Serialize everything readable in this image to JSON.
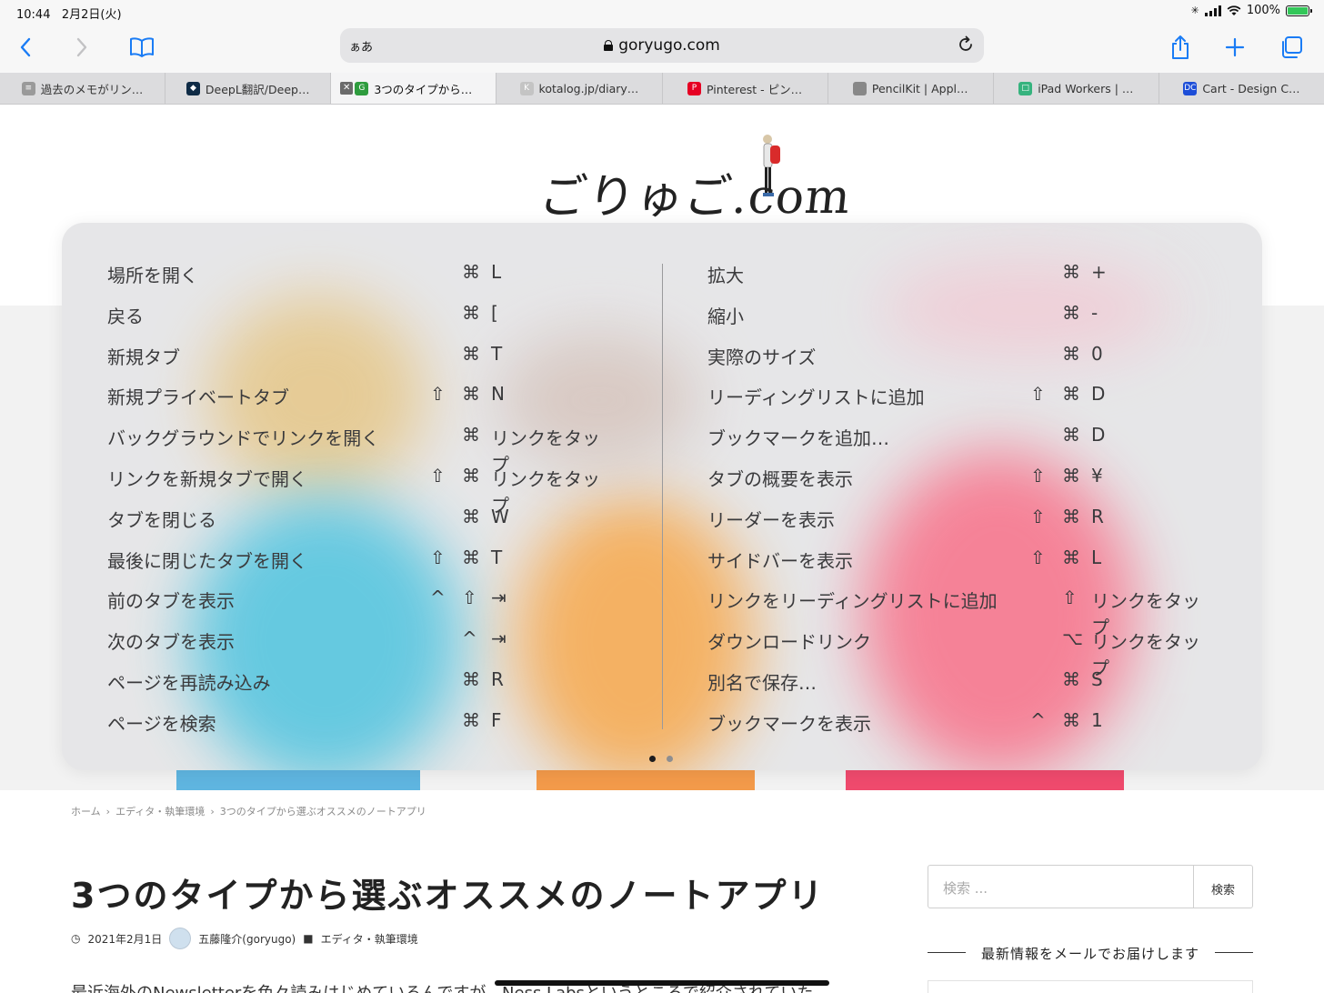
{
  "status": {
    "time": "10:44",
    "date": "2月2日(火)",
    "battery": "100%",
    "battery_fill": 1.0
  },
  "toolbar": {
    "text_size_label": "ぁあ",
    "url": "goryugo.com"
  },
  "tabs": [
    {
      "label": "過去のメモがリン…",
      "fav_color": "#9a9a9a",
      "fav_text": "≡"
    },
    {
      "label": "DeepL翻訳/Deep…",
      "fav_color": "#0f2b46",
      "fav_text": "◆"
    },
    {
      "label": "3つのタイプから…",
      "fav_color": "#2e9c3e",
      "fav_text": "G",
      "active": true
    },
    {
      "label": "kotalog.jp/diary…",
      "fav_color": "#c4c4c4",
      "fav_text": "K"
    },
    {
      "label": "Pinterest - ピン…",
      "fav_color": "#e60023",
      "fav_text": "P"
    },
    {
      "label": "PencilKit | Appl…",
      "fav_color": "#888888",
      "fav_text": ""
    },
    {
      "label": "iPad Workers | …",
      "fav_color": "#36b37e",
      "fav_text": "□"
    },
    {
      "label": "Cart - Design C…",
      "fav_color": "#1d4ed8",
      "fav_text": "DC"
    }
  ],
  "logo": {
    "text": "ごりゅご.com"
  },
  "shortcuts": {
    "left": [
      {
        "label": "場所を開く",
        "mods": [
          "",
          "⌘"
        ],
        "key": "L"
      },
      {
        "label": "戻る",
        "mods": [
          "",
          "⌘"
        ],
        "key": "["
      },
      {
        "label": "新規タブ",
        "mods": [
          "",
          "⌘"
        ],
        "key": "T"
      },
      {
        "label": "新規プライベートタブ",
        "mods": [
          "⇧",
          "⌘"
        ],
        "key": "N"
      },
      {
        "label": "バックグラウンドでリンクを開く",
        "mods": [
          "",
          "⌘"
        ],
        "key": "リンクをタップ"
      },
      {
        "label": "リンクを新規タブで開く",
        "mods": [
          "⇧",
          "⌘"
        ],
        "key": "リンクをタップ"
      },
      {
        "label": "タブを閉じる",
        "mods": [
          "",
          "⌘"
        ],
        "key": "W"
      },
      {
        "label": "最後に閉じたタブを開く",
        "mods": [
          "⇧",
          "⌘"
        ],
        "key": "T"
      },
      {
        "label": "前のタブを表示",
        "mods": [
          "^",
          "⇧"
        ],
        "key": "⇥"
      },
      {
        "label": "次のタブを表示",
        "mods": [
          "",
          "^"
        ],
        "key": "⇥"
      },
      {
        "label": "ページを再読み込み",
        "mods": [
          "",
          "⌘"
        ],
        "key": "R"
      },
      {
        "label": "ページを検索",
        "mods": [
          "",
          "⌘"
        ],
        "key": "F"
      }
    ],
    "right": [
      {
        "label": "拡大",
        "mods": [
          "",
          "⌘"
        ],
        "key": "+"
      },
      {
        "label": "縮小",
        "mods": [
          "",
          "⌘"
        ],
        "key": "-"
      },
      {
        "label": "実際のサイズ",
        "mods": [
          "",
          "⌘"
        ],
        "key": "0"
      },
      {
        "label": "リーディングリストに追加",
        "mods": [
          "⇧",
          "⌘"
        ],
        "key": "D"
      },
      {
        "label": "ブックマークを追加…",
        "mods": [
          "",
          "⌘"
        ],
        "key": "D"
      },
      {
        "label": "タブの概要を表示",
        "mods": [
          "⇧",
          "⌘"
        ],
        "key": "¥"
      },
      {
        "label": "リーダーを表示",
        "mods": [
          "⇧",
          "⌘"
        ],
        "key": "R"
      },
      {
        "label": "サイドバーを表示",
        "mods": [
          "⇧",
          "⌘"
        ],
        "key": "L"
      },
      {
        "label": "リンクをリーディングリストに追加",
        "mods": [
          "",
          "⇧"
        ],
        "key": "リンクをタップ"
      },
      {
        "label": "ダウンロードリンク",
        "mods": [
          "",
          "⌥"
        ],
        "key": "リンクをタップ"
      },
      {
        "label": "別名で保存…",
        "mods": [
          "",
          "⌘"
        ],
        "key": "S"
      },
      {
        "label": "ブックマークを表示",
        "mods": [
          "^",
          "⌘"
        ],
        "key": "1"
      }
    ]
  },
  "breadcrumb": [
    "ホーム",
    "›",
    "エディタ・執筆環境",
    "›",
    "3つのタイプから選ぶオススメのノートアプリ"
  ],
  "article": {
    "title": "3つのタイプから選ぶオススメのノートアプリ",
    "date": "2021年2月1日",
    "author": "五藤隆介(goryugo)",
    "category": "エディタ・執筆環境",
    "body_start": "最近海外のNewsletterを色々読みはじめているんですが、Ness Labsというところで紹介されていた"
  },
  "sidebar": {
    "search_placeholder": "検索 ...",
    "search_button": "検索",
    "mail_heading": "最新情報をメールでお届けします"
  }
}
